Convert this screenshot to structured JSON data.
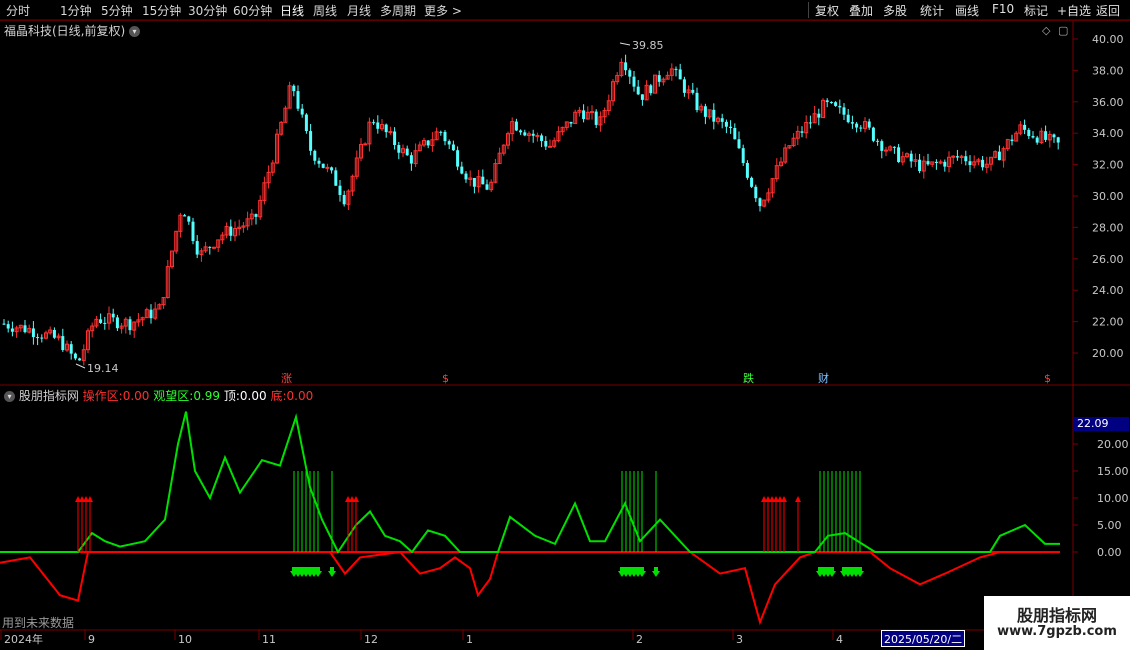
{
  "toolbar": {
    "periods": [
      "分时",
      "1分钟",
      "5分钟",
      "15分钟",
      "30分钟",
      "60分钟",
      "日线",
      "周线",
      "月线",
      "多周期",
      "更多 >"
    ],
    "active_period": "日线",
    "actions": [
      "复权",
      "叠加",
      "多股",
      "统计",
      "画线",
      "F10",
      "标记",
      "+自选",
      "返回"
    ]
  },
  "main_chart": {
    "title": "福晶科技(日线,前复权)",
    "y_ticks": [
      "40.00",
      "38.00",
      "36.00",
      "34.00",
      "32.00",
      "30.00",
      "28.00",
      "26.00",
      "24.00",
      "22.00",
      "20.00"
    ],
    "high_label": "39.85",
    "low_label": "19.14",
    "markers": [
      {
        "text": "涨",
        "color": "#ff4040"
      },
      {
        "text": "$",
        "color": "#ff4040"
      },
      {
        "text": "跌",
        "color": "#40ff40"
      },
      {
        "text": "财",
        "color": "#80c0ff"
      },
      {
        "text": "$",
        "color": "#ff4040"
      }
    ]
  },
  "indicator": {
    "name": "股朋指标网",
    "fields": [
      {
        "label": "操作区:",
        "value": "0.00",
        "color": "#ff3030"
      },
      {
        "label": "观望区:",
        "value": "0.99",
        "color": "#30ff30"
      },
      {
        "label": "顶:",
        "value": "0.00",
        "color": "#ffffff"
      },
      {
        "label": "底:",
        "value": "0.00",
        "color": "#ff3030"
      }
    ],
    "current_value": "22.09",
    "y_ticks": [
      "20.00",
      "15.00",
      "10.00",
      "5.00",
      "0.00"
    ]
  },
  "x_axis": {
    "labels": [
      "2024年",
      "9",
      "10",
      "11",
      "12",
      "1",
      "2",
      "3",
      "4",
      "5"
    ],
    "cursor_date": "2025/05/20/二"
  },
  "footnote": "用到未来数据",
  "watermark": {
    "title": "股朋指标网",
    "url": "www.7gpzb.com"
  },
  "colors": {
    "up": "#ff3232",
    "down": "#54ffff",
    "ma_green": "#00e000",
    "ma_red": "#ff0000",
    "grid": "#7a0000"
  }
}
